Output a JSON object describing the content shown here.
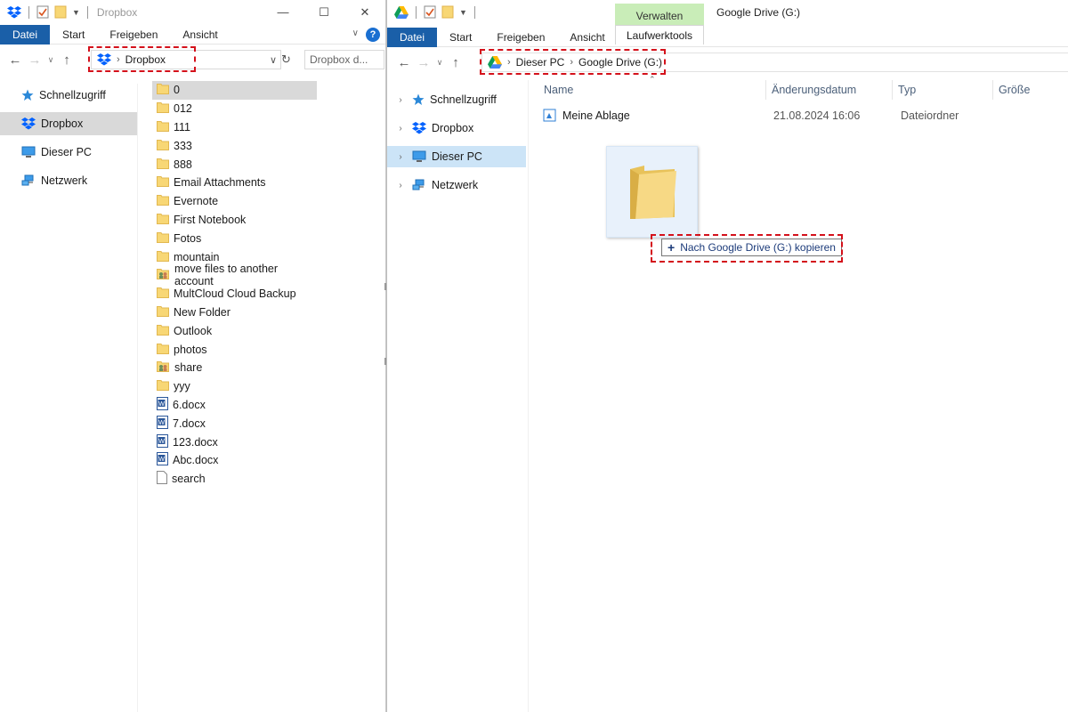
{
  "left": {
    "title": "Dropbox",
    "tabs": [
      "Datei",
      "Start",
      "Freigeben",
      "Ansicht"
    ],
    "breadcrumb": [
      "Dropbox"
    ],
    "search_placeholder": "Dropbox d...",
    "nav": [
      {
        "label": "Schnellzugriff",
        "icon": "star-icon"
      },
      {
        "label": "Dropbox",
        "icon": "dropbox-icon",
        "selected": true
      },
      {
        "label": "Dieser PC",
        "icon": "computer-icon"
      },
      {
        "label": "Netzwerk",
        "icon": "network-icon"
      }
    ],
    "files": [
      {
        "name": "0",
        "type": "folder",
        "selected": true
      },
      {
        "name": "012",
        "type": "folder"
      },
      {
        "name": "111",
        "type": "folder"
      },
      {
        "name": "333",
        "type": "folder"
      },
      {
        "name": "888",
        "type": "folder"
      },
      {
        "name": "Email Attachments",
        "type": "folder"
      },
      {
        "name": "Evernote",
        "type": "folder"
      },
      {
        "name": "First Notebook",
        "type": "folder"
      },
      {
        "name": "Fotos",
        "type": "folder"
      },
      {
        "name": "mountain",
        "type": "folder"
      },
      {
        "name": "move files to another account",
        "type": "shared-folder"
      },
      {
        "name": "MultCloud Cloud Backup",
        "type": "folder"
      },
      {
        "name": "New Folder",
        "type": "folder"
      },
      {
        "name": "Outlook",
        "type": "folder"
      },
      {
        "name": "photos",
        "type": "folder"
      },
      {
        "name": "share",
        "type": "shared-folder"
      },
      {
        "name": "yyy",
        "type": "folder"
      },
      {
        "name": "6.docx",
        "type": "word"
      },
      {
        "name": "7.docx",
        "type": "word"
      },
      {
        "name": "123.docx",
        "type": "word"
      },
      {
        "name": "Abc.docx",
        "type": "word"
      },
      {
        "name": "search",
        "type": "file"
      }
    ]
  },
  "right": {
    "title": "Google Drive (G:)",
    "manage_tab": "Verwalten",
    "tabs": [
      "Datei",
      "Start",
      "Freigeben",
      "Ansicht"
    ],
    "drive_tools_tab": "Laufwerktools",
    "breadcrumb": [
      "Dieser PC",
      "Google Drive (G:)"
    ],
    "nav": [
      {
        "label": "Schnellzugriff",
        "icon": "star-icon"
      },
      {
        "label": "Dropbox",
        "icon": "dropbox-icon"
      },
      {
        "label": "Dieser PC",
        "icon": "computer-icon",
        "selected": true
      },
      {
        "label": "Netzwerk",
        "icon": "network-icon"
      }
    ],
    "columns": [
      "Name",
      "Änderungsdatum",
      "Typ",
      "Größe"
    ],
    "rows": [
      {
        "name": "Meine Ablage",
        "date": "21.08.2024 16:06",
        "type": "Dateiordner",
        "size": ""
      }
    ],
    "drag_tooltip": "Nach Google Drive (G:) kopieren"
  },
  "colors": {
    "file_tab": "#1a5fa8",
    "highlight": "#d4111b",
    "manage_tab": "#c9edb8",
    "selected_nav_right": "#cce4f7",
    "selected_gray": "#d9d9d9"
  }
}
